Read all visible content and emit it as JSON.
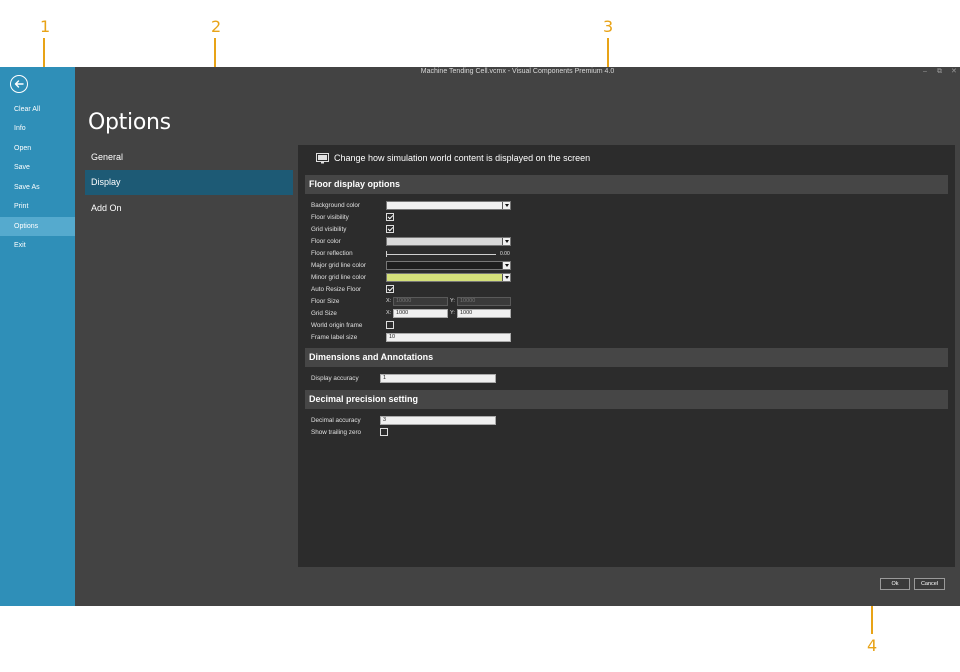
{
  "callouts": [
    "1",
    "2",
    "3",
    "4"
  ],
  "window": {
    "title": "Machine Tending Cell.vcmx - Visual Components Premium 4.0",
    "controls": [
      "–",
      "⧉",
      "✕"
    ]
  },
  "backstage": {
    "back_icon": "back-arrow-icon",
    "items": [
      "Clear All",
      "Info",
      "Open",
      "Save",
      "Save As",
      "Print",
      "Options",
      "Exit"
    ],
    "active": "Options"
  },
  "options": {
    "title": "Options",
    "categories": [
      "General",
      "Display",
      "Add On"
    ],
    "active": "Display"
  },
  "panel": {
    "icon": "monitor-icon",
    "description": "Change how simulation world content is displayed on the screen",
    "floor": {
      "header": "Floor display options",
      "background_color_label": "Background color",
      "floor_visibility_label": "Floor visibility",
      "grid_visibility_label": "Grid visibility",
      "floor_color_label": "Floor color",
      "floor_reflection_label": "Floor reflection",
      "floor_reflection_value": "0.00",
      "major_grid_label": "Major grid line color",
      "minor_grid_label": "Minor grid line color",
      "auto_resize_label": "Auto Resize Floor",
      "floor_size_label": "Floor Size",
      "floor_size_x": "10000",
      "floor_size_y": "10000",
      "grid_size_label": "Grid Size",
      "grid_size_x": "1000",
      "grid_size_y": "1000",
      "world_origin_label": "World origin frame",
      "frame_label_size_label": "Frame label size",
      "frame_label_size_value": "10",
      "x_label": "X:",
      "y_label": "Y:",
      "checked": {
        "floor_visibility": true,
        "grid_visibility": true,
        "auto_resize": true,
        "world_origin": false
      }
    },
    "dimensions": {
      "header": "Dimensions and Annotations",
      "display_accuracy_label": "Display accuracy",
      "display_accuracy_value": "1"
    },
    "decimal": {
      "header": "Decimal precision setting",
      "decimal_accuracy_label": "Decimal accuracy",
      "decimal_accuracy_value": "3",
      "show_trailing_zero_label": "Show trailing zero",
      "show_trailing_zero_checked": false
    }
  },
  "footer": {
    "ok_label": "Ok",
    "cancel_label": "Cancel"
  },
  "colors": {
    "sidebar": "#2f8fb8",
    "sidebar_active": "#55aace",
    "category_active": "#1d5a75",
    "background_color": "#f0f0f0",
    "floor_color": "#d9d9d9",
    "major_grid_color": "#1e1e1e",
    "minor_grid_color": "#d4e07a",
    "callout": "#e8a317"
  }
}
